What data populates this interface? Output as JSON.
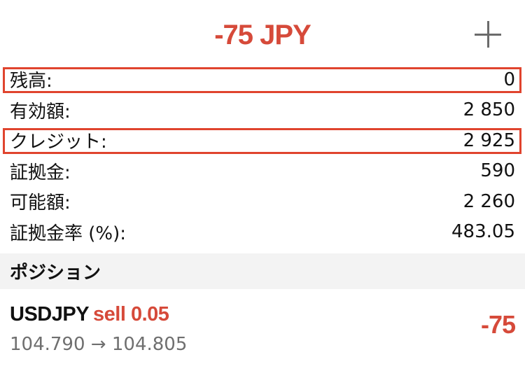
{
  "header": {
    "balance_change": "-75 JPY"
  },
  "summary": [
    {
      "label": "残高:",
      "value": "0",
      "highlighted": true
    },
    {
      "label": "有効額:",
      "value": "2 850",
      "highlighted": false
    },
    {
      "label": "クレジット:",
      "value": "2 925",
      "highlighted": true
    },
    {
      "label": "証拠金:",
      "value": "590",
      "highlighted": false
    },
    {
      "label": "可能額:",
      "value": "2 260",
      "highlighted": false
    },
    {
      "label": "証拠金率 (%):",
      "value": "483.05",
      "highlighted": false
    }
  ],
  "positions_section": {
    "title": "ポジション"
  },
  "positions": [
    {
      "symbol": "USDJPY",
      "side_volume": "sell 0.05",
      "open_price": "104.790",
      "arrow": "→",
      "current_price": "104.805",
      "profit": "-75"
    }
  ],
  "colors": {
    "loss": "#d64a3a",
    "highlight_border": "#e0442e",
    "section_bg": "#f3f3f3"
  },
  "icons": {
    "add": "plus-icon"
  }
}
